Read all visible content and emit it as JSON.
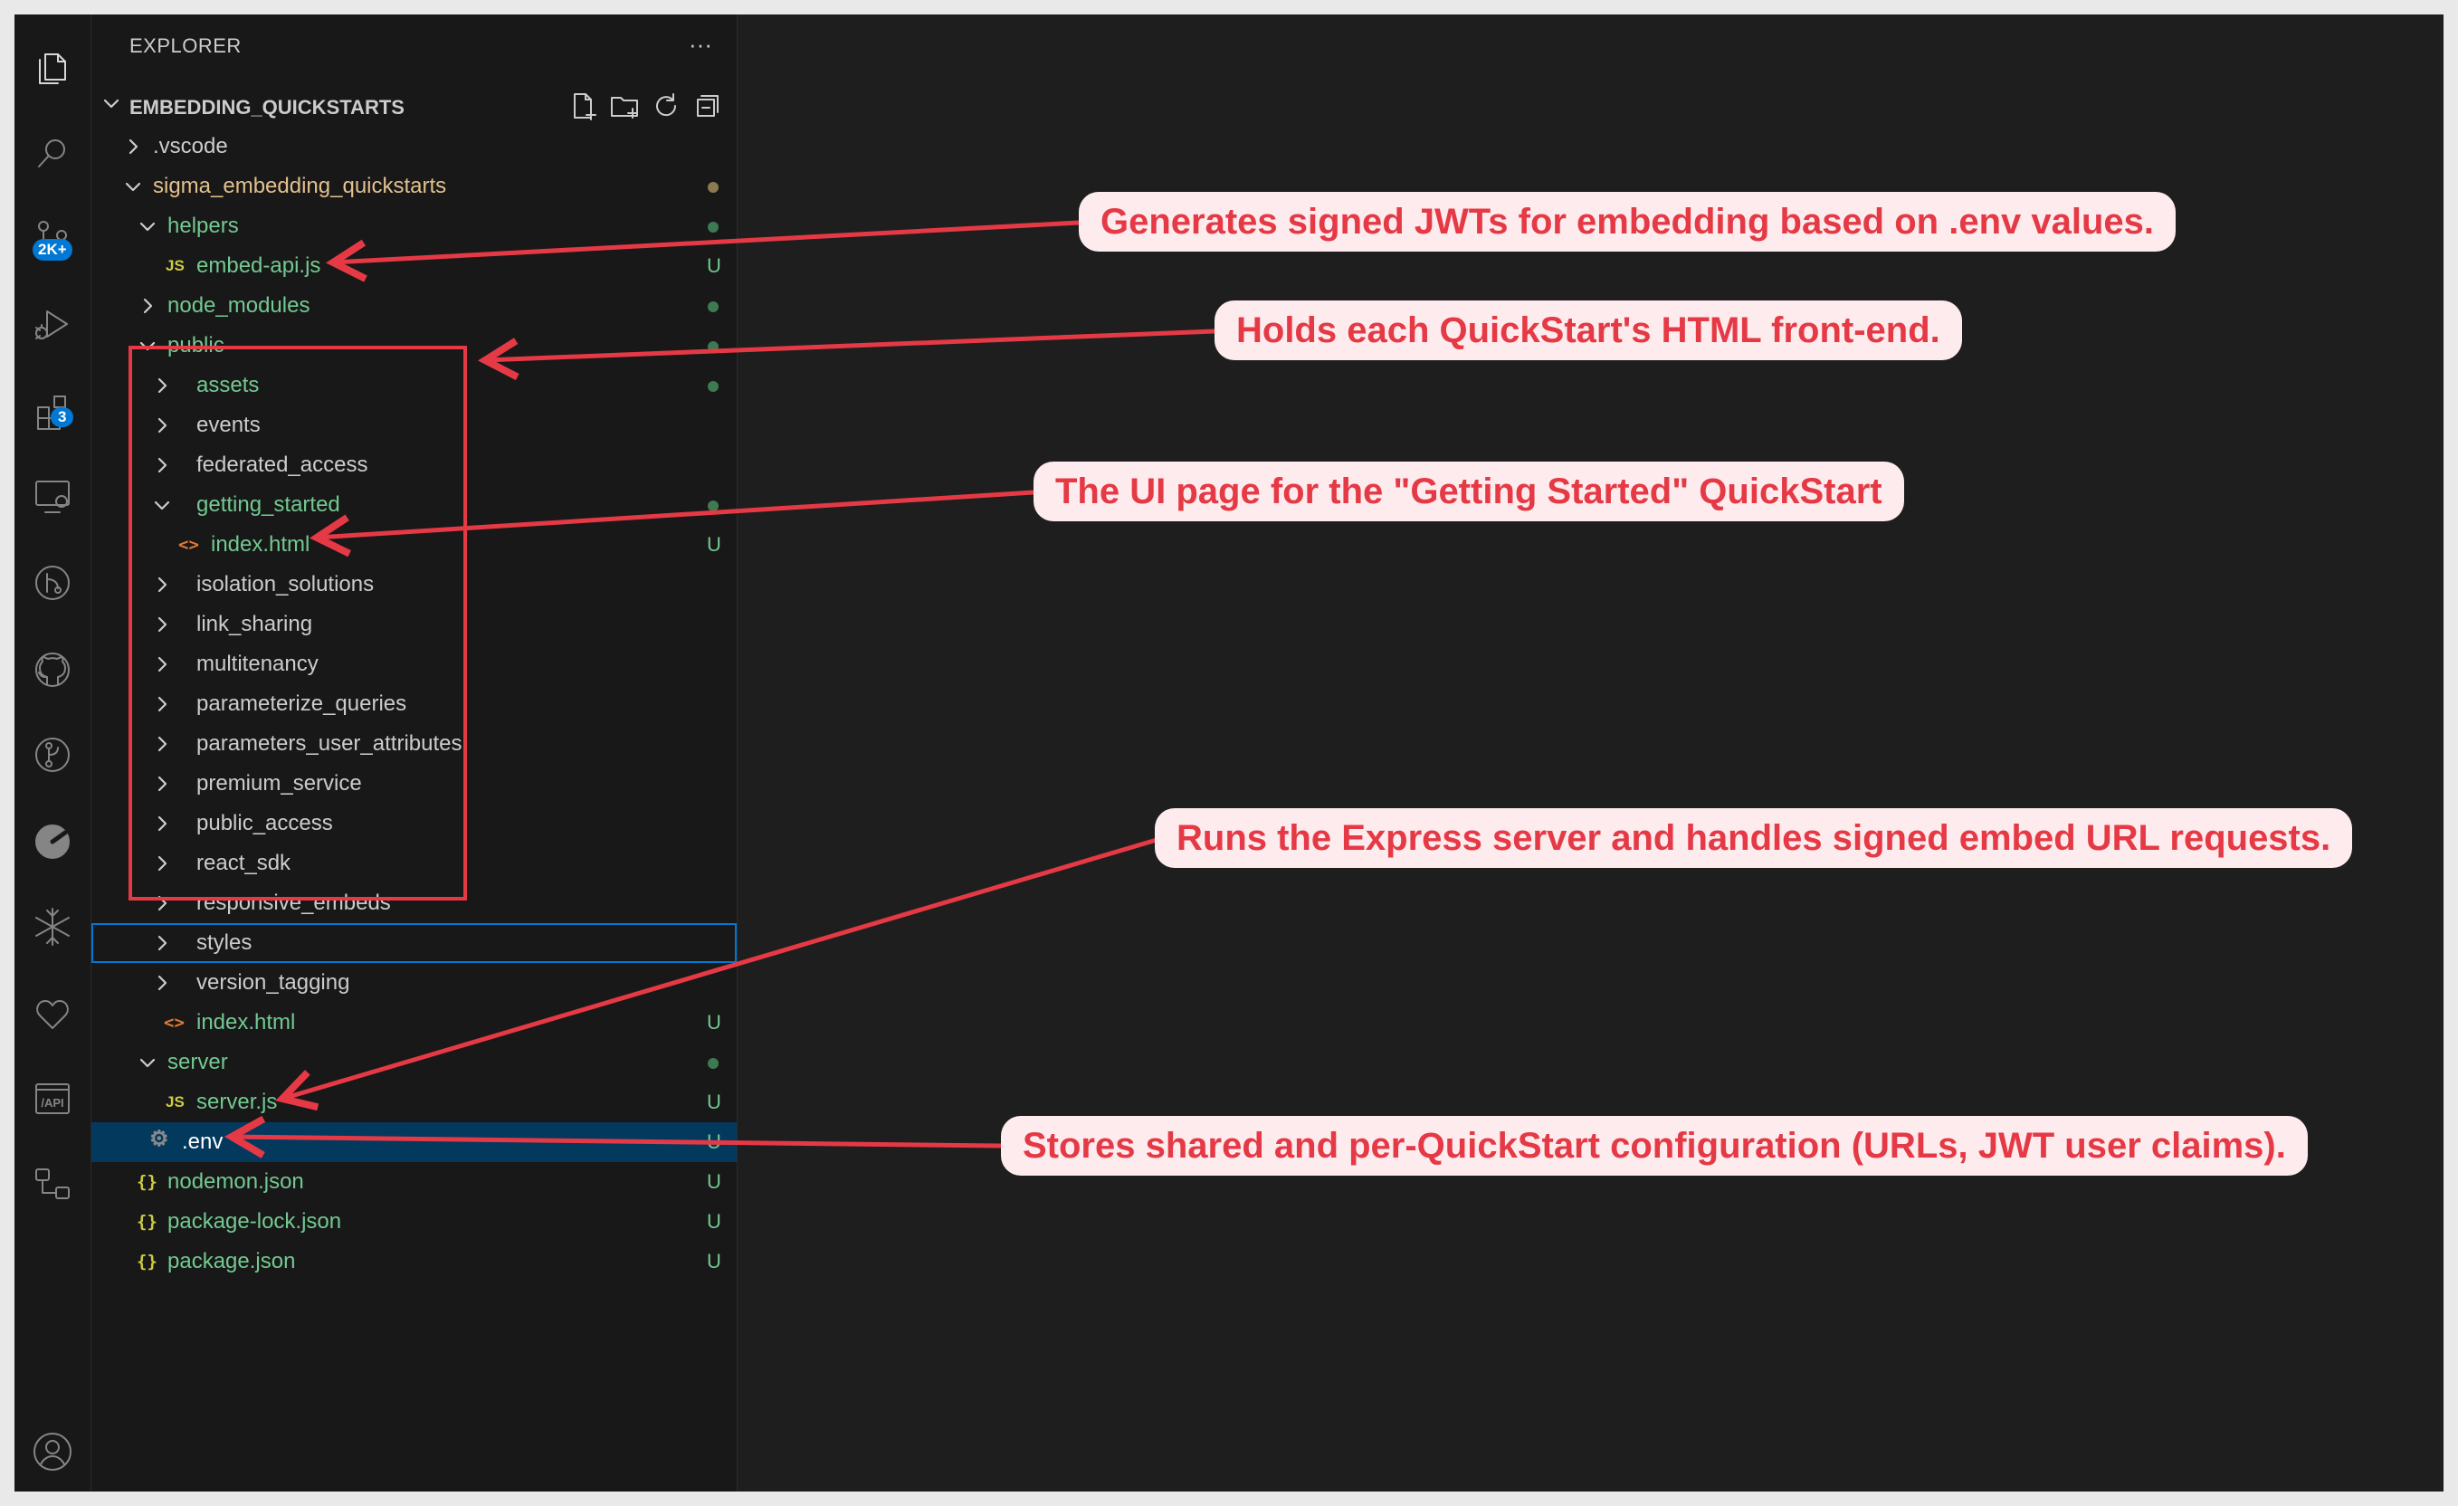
{
  "activity_bar": {
    "scm_badge": "2K+",
    "extensions_badge": "3"
  },
  "explorer": {
    "title": "EXPLORER",
    "more_label": "···",
    "workspace_name": "EMBEDDING_QUICKSTARTS",
    "tree": [
      {
        "label": "vscode_dir",
        "text": ".vscode"
      },
      {
        "text": "sigma_embedding_quickstarts"
      },
      {
        "text": "helpers"
      },
      {
        "text": "embed-api.js",
        "status": "U"
      },
      {
        "text": "node_modules"
      },
      {
        "text": "public"
      },
      {
        "text": "assets"
      },
      {
        "text": "events"
      },
      {
        "text": "federated_access"
      },
      {
        "text": "getting_started"
      },
      {
        "text": "index.html",
        "status": "U"
      },
      {
        "text": "isolation_solutions"
      },
      {
        "text": "link_sharing"
      },
      {
        "text": "multitenancy"
      },
      {
        "text": "parameterize_queries"
      },
      {
        "text": "parameters_user_attributes"
      },
      {
        "text": "premium_service"
      },
      {
        "text": "public_access"
      },
      {
        "text": "react_sdk"
      },
      {
        "text": "responsive_embeds"
      },
      {
        "text": "styles"
      },
      {
        "text": "version_tagging"
      },
      {
        "text": "index.html",
        "status": "U"
      },
      {
        "text": "server"
      },
      {
        "text": "server.js",
        "status": "U"
      },
      {
        "text": ".env",
        "status": "U"
      },
      {
        "text": "nodemon.json",
        "status": "U"
      },
      {
        "text": "package-lock.json",
        "status": "U"
      },
      {
        "text": "package.json",
        "status": "U"
      }
    ]
  },
  "file_icons": {
    "js": "JS",
    "html": "<>",
    "json": "{}",
    "env": "⚙"
  },
  "annotations": {
    "embed_api": "Generates signed JWTs for embedding based on .env values.",
    "public": "Holds each QuickStart's HTML front-end.",
    "getting_started": "The UI page for the \"Getting Started\" QuickStart",
    "server": "Runs the Express server and handles signed embed URL requests.",
    "env": "Stores shared and per-QuickStart configuration (URLs, JWT user claims)."
  },
  "colors": {
    "annotation_red": "#e53945",
    "annotation_bg": "#fdebed",
    "git_untracked": "#73c991",
    "selection": "#04395e",
    "focus": "#0078d4"
  }
}
